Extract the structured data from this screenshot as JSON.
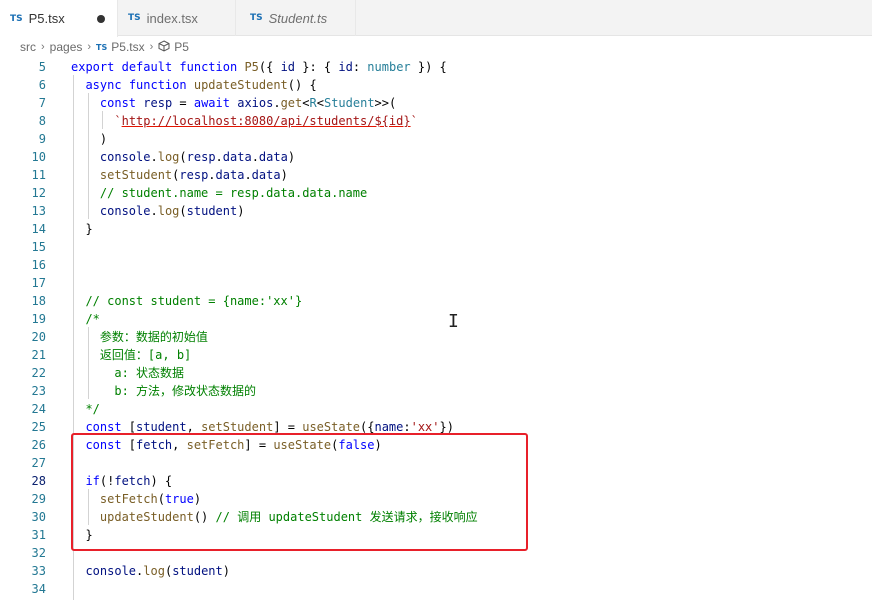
{
  "tabs": [
    {
      "badge": "TS",
      "label": "P5.tsx",
      "active": true,
      "modified": true
    },
    {
      "badge": "TS",
      "label": "index.tsx",
      "active": false
    },
    {
      "badge": "TS",
      "label": "Student.ts",
      "active": false
    }
  ],
  "breadcrumb": {
    "parts": [
      "src",
      "pages",
      "P5.tsx",
      "P5"
    ],
    "badge": "TS"
  },
  "code_lines": [
    {
      "n": "5",
      "html": "<span class=\"kw\">export</span> <span class=\"kw\">default</span> <span class=\"kw\">function</span> <span class=\"fn\">P5</span>({ <span class=\"var\">id</span> }: { <span class=\"var\">id</span>: <span class=\"type\">number</span> }) {"
    },
    {
      "n": "6",
      "html": "  <span class=\"kw\">async</span> <span class=\"kw\">function</span> <span class=\"fn\">updateStudent</span>() {"
    },
    {
      "n": "7",
      "html": "    <span class=\"kw\">const</span> <span class=\"var\">resp</span> = <span class=\"kw\">await</span> <span class=\"var\">axios</span>.<span class=\"fn\">get</span>&lt;<span class=\"type\">R</span>&lt;<span class=\"type\">Student</span>&gt;&gt;("
    },
    {
      "n": "8",
      "html": "      <span class=\"str\">`</span><span class=\"url\">http://localhost:8080/api/students/${id}</span><span class=\"str\">`</span>"
    },
    {
      "n": "9",
      "html": "    )"
    },
    {
      "n": "10",
      "html": "    <span class=\"var\">console</span>.<span class=\"fn\">log</span>(<span class=\"var\">resp</span>.<span class=\"var\">data</span>.<span class=\"var\">data</span>)"
    },
    {
      "n": "11",
      "html": "    <span class=\"fn\">setStudent</span>(<span class=\"var\">resp</span>.<span class=\"var\">data</span>.<span class=\"var\">data</span>)"
    },
    {
      "n": "12",
      "html": "    <span class=\"cmt\">// student.name = resp.data.data.name</span>"
    },
    {
      "n": "13",
      "html": "    <span class=\"var\">console</span>.<span class=\"fn\">log</span>(<span class=\"var\">student</span>)"
    },
    {
      "n": "14",
      "html": "  }"
    },
    {
      "n": "15",
      "html": ""
    },
    {
      "n": "16",
      "html": ""
    },
    {
      "n": "17",
      "html": ""
    },
    {
      "n": "18",
      "html": "  <span class=\"cmt\">// const student = {name:'xx'}</span>"
    },
    {
      "n": "19",
      "html": "  <span class=\"cmt\">/*</span>"
    },
    {
      "n": "20",
      "html": "<span class=\"cmt\">    <span class=\"cjk\">参数：数据的初始值</span></span>"
    },
    {
      "n": "21",
      "html": "<span class=\"cmt\">    <span class=\"cjk\">返回值：</span>[a, b]</span>"
    },
    {
      "n": "22",
      "html": "<span class=\"cmt\">      a: <span class=\"cjk\">状态数据</span></span>"
    },
    {
      "n": "23",
      "html": "<span class=\"cmt\">      b: <span class=\"cjk\">方法，修改状态数据的</span></span>"
    },
    {
      "n": "24",
      "html": "<span class=\"cmt\">  */</span>"
    },
    {
      "n": "25",
      "html": "  <span class=\"kw\">const</span> [<span class=\"var\">student</span>, <span class=\"fn\">setStudent</span>] = <span class=\"fn\">useState</span>({<span class=\"var\">name</span>:<span class=\"str\">'xx'</span>})"
    },
    {
      "n": "26",
      "html": "  <span class=\"kw\">const</span> [<span class=\"var\">fetch</span>, <span class=\"fn\">setFetch</span>] = <span class=\"fn\">useState</span>(<span class=\"kw\">false</span>)"
    },
    {
      "n": "27",
      "html": ""
    },
    {
      "n": "28",
      "html": "  <span class=\"kw\">if</span>(!<span class=\"var\">fetch</span>) {"
    },
    {
      "n": "29",
      "html": "    <span class=\"fn\">setFetch</span>(<span class=\"kw\">true</span>)"
    },
    {
      "n": "30",
      "html": "    <span class=\"fn\">updateStudent</span>() <span class=\"cmt\">// <span class=\"cjk\">调用</span> updateStudent <span class=\"cjk\">发送请求，接收响应</span></span>"
    },
    {
      "n": "31",
      "html": "  }"
    },
    {
      "n": "32",
      "html": ""
    },
    {
      "n": "33",
      "html": "  <span class=\"var\">console</span>.<span class=\"fn\">log</span>(<span class=\"var\">student</span>)"
    },
    {
      "n": "34",
      "html": ""
    }
  ],
  "current_line": "28"
}
